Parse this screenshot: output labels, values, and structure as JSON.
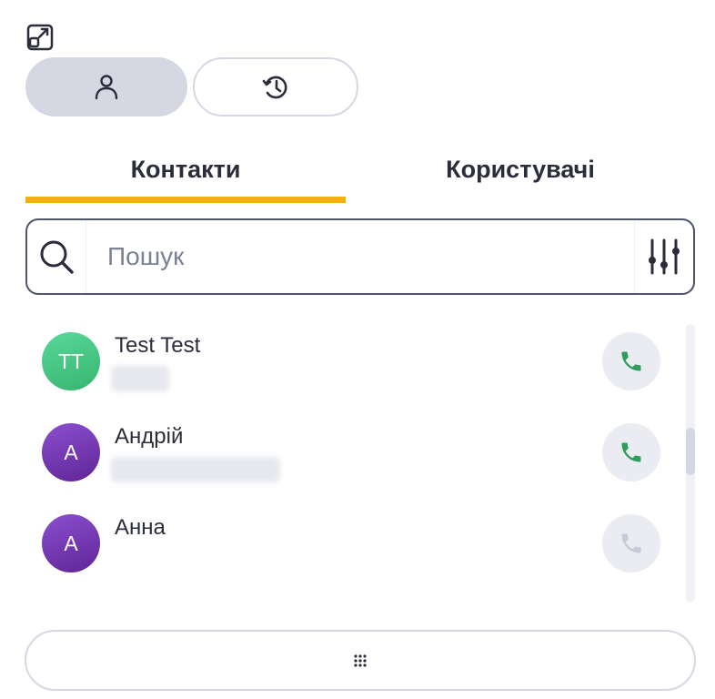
{
  "icons": {
    "expand": "expand-window-icon",
    "contacts_mode": "person-icon",
    "history_mode": "history-clock-icon",
    "search": "search-icon",
    "filter": "filter-sliders-icon",
    "call": "phone-icon",
    "dialpad": "dialpad-icon"
  },
  "tabs": [
    {
      "label": "Контакти",
      "active": true
    },
    {
      "label": "Користувачі",
      "active": false
    }
  ],
  "search": {
    "placeholder": "Пошук",
    "value": ""
  },
  "contacts": [
    {
      "initials": "TT",
      "name": "Test Test",
      "call_enabled": true
    },
    {
      "initials": "A",
      "name": "Андрій",
      "call_enabled": true
    },
    {
      "initials": "A",
      "name": "Анна",
      "call_enabled": false
    }
  ],
  "scroll": {
    "position": 0.45
  },
  "colors": {
    "accent_underline": "#f5b10b",
    "active_mode_bg": "#d5d8e3",
    "border": "#4e5469",
    "call_green": "#2f9e5c",
    "call_disabled": "#c6cad6",
    "avatar_green": "#3fc47c",
    "avatar_purple": "#6e2fa8"
  }
}
